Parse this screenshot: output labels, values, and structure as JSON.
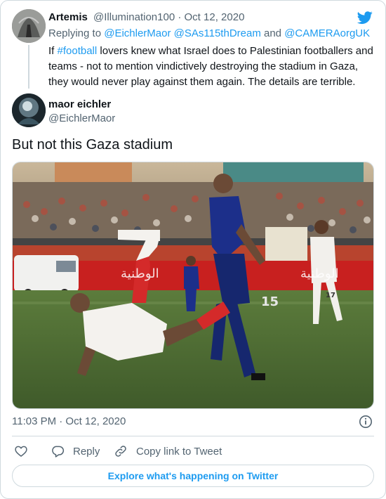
{
  "parent_tweet": {
    "author_name": "Artemis",
    "author_handle": "@Illumination100",
    "separator": " · ",
    "date": "Oct 12, 2020",
    "replying_prefix": "Replying to ",
    "replying_handle_1": "@EichlerMaor",
    "replying_handle_2": "@SAs115thDream",
    "replying_and": " and ",
    "replying_handle_3": "@CAMERAorgUK",
    "text_prefix": "If ",
    "hashtag": "#football",
    "text_body": " lovers knew what Israel does to Palestinian footballers and teams - not to mention vindictively destroying the stadium in Gaza, they would never play against them again. The details are terrible."
  },
  "main_tweet": {
    "author_name": "maor eichler",
    "author_handle": "@EichlerMaor",
    "text": "But not this Gaza stadium",
    "timestamp": "11:03 PM · Oct 12, 2020"
  },
  "photo": {
    "banner_text_1": "الوطنية",
    "banner_text_2": "الوطنية",
    "player_number_blue": "15",
    "player_number_white": "17"
  },
  "actions": {
    "reply_label": "Reply",
    "copy_link_label": "Copy link to Tweet"
  },
  "footer": {
    "explore_label": "Explore what's happening on Twitter"
  },
  "colors": {
    "accent": "#1d9bf0",
    "muted_text": "#536471",
    "border": "#cfd9de",
    "text": "#0f1419"
  }
}
